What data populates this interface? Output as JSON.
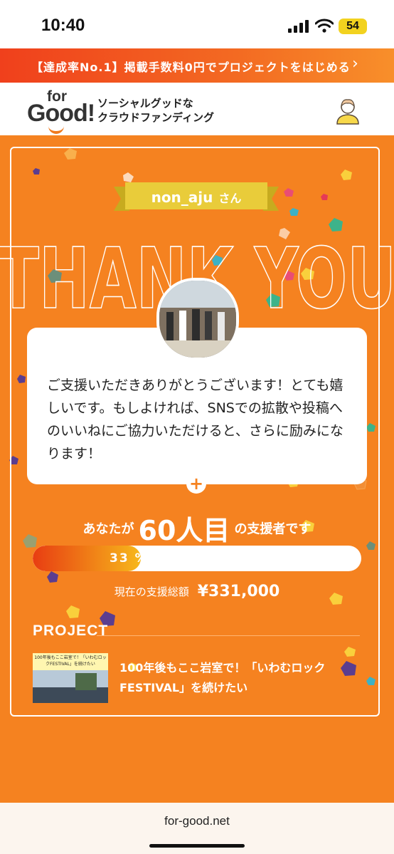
{
  "status_bar": {
    "time": "10:40",
    "battery": "54"
  },
  "banner": {
    "text": "【達成率No.1】掲載手数料0円でプロジェクトをはじめる",
    "chevron": "›"
  },
  "header": {
    "logo_for": "for",
    "logo_good": "Good!",
    "tagline_line1": "ソーシャルグッドな",
    "tagline_line2": "クラウドファンディング"
  },
  "thanks": {
    "supporter_name": "non_aju",
    "honorific": "さん",
    "big_text": "THANK YOU",
    "message": "ご支援いただきありがとうございます！とても嬉しいです。もしよければ、SNSでの拡散や投稿へのいいねにご協力いただけると、さらに励みになります！",
    "plus": "+"
  },
  "rank": {
    "prefix": "あなたが",
    "number": "60人目",
    "suffix": "の支援者です"
  },
  "progress": {
    "percent_label": "33 %",
    "fraction": 0.33
  },
  "total": {
    "label": "現在の支援総額",
    "value": "¥331,000"
  },
  "project": {
    "heading": "PROJECT",
    "thumb_text": "100年後もここ岩室で！「いわむロックFESTIVAL」を続けたい",
    "title": "100年後もここ岩室で！「いわむロックFESTIVAL」を続けたい"
  },
  "footer": {
    "url": "for-good.net"
  },
  "colors": {
    "brand_orange": "#f58220",
    "banner_red": "#f0401c",
    "ribbon_yellow": "#e9cc3a"
  }
}
